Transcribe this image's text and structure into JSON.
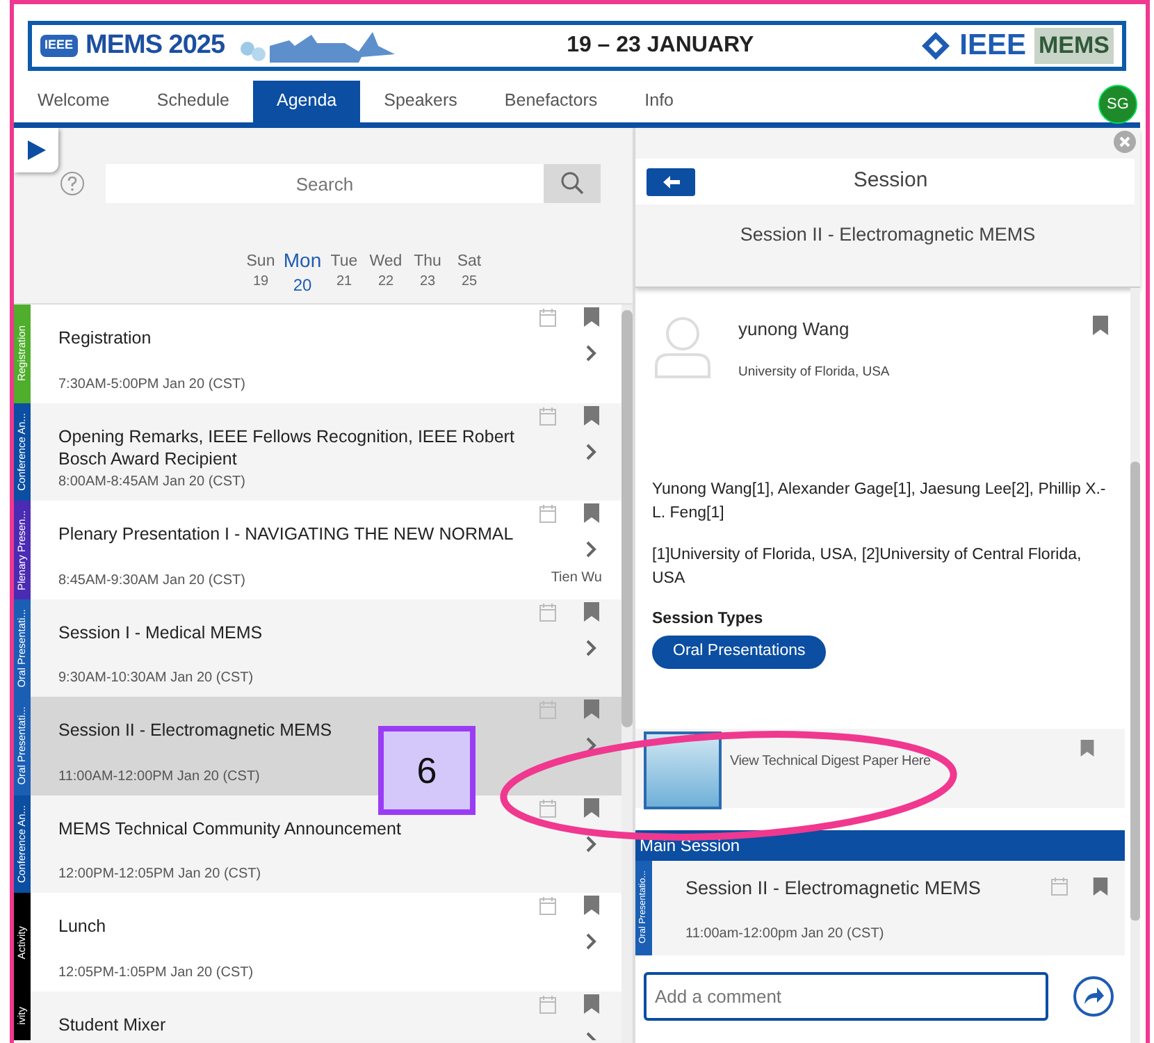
{
  "banner": {
    "logo_badge": "IEEE",
    "logo_text": "MEMS 2025",
    "dates": "19 – 23 JANUARY",
    "org_logo": "IEEE",
    "partner_logo": "MEMS"
  },
  "tabs": [
    {
      "label": "Welcome",
      "selected": false
    },
    {
      "label": "Schedule",
      "selected": false
    },
    {
      "label": "Agenda",
      "selected": true
    },
    {
      "label": "Speakers",
      "selected": false
    },
    {
      "label": "Benefactors",
      "selected": false
    },
    {
      "label": "Info",
      "selected": false
    }
  ],
  "user_avatar": "SG",
  "search": {
    "placeholder": "Search"
  },
  "days": [
    {
      "name": "Sun",
      "date": "19",
      "selected": false
    },
    {
      "name": "Mon",
      "date": "20",
      "selected": true
    },
    {
      "name": "Tue",
      "date": "21",
      "selected": false
    },
    {
      "name": "Wed",
      "date": "22",
      "selected": false
    },
    {
      "name": "Thu",
      "date": "23",
      "selected": false
    },
    {
      "name": "Sat",
      "date": "25",
      "selected": false
    }
  ],
  "agenda": [
    {
      "category": "Registration",
      "color": "#4fae2c",
      "title": "Registration",
      "time": "7:30AM-5:00PM Jan 20 (CST)",
      "selected": false
    },
    {
      "category": "Conference An...",
      "color": "#0b4ea2",
      "title": "Opening Remarks, IEEE Fellows Recognition, IEEE Robert Bosch Award Recipient",
      "time": "8:00AM-8:45AM Jan 20 (CST)",
      "selected": false
    },
    {
      "category": "Plenary Presen...",
      "color": "#4b2bb3",
      "title": "Plenary Presentation I - NAVIGATING THE NEW NORMAL",
      "time": "8:45AM-9:30AM Jan 20 (CST)",
      "speaker": "Tien Wu",
      "selected": false
    },
    {
      "category": "Oral Presentati...",
      "color": "#1a5fb4",
      "title": "Session I - Medical MEMS",
      "time": "9:30AM-10:30AM Jan 20 (CST)",
      "selected": false
    },
    {
      "category": "Oral Presentati...",
      "color": "#1a5fb4",
      "title": "Session II - Electromagnetic MEMS",
      "time": "11:00AM-12:00PM Jan 20 (CST)",
      "selected": true
    },
    {
      "category": "Conference An...",
      "color": "#0b4ea2",
      "title": "MEMS Technical Community Announcement",
      "time": "12:00PM-12:05PM Jan 20 (CST)",
      "selected": false
    },
    {
      "category": "Activity",
      "color": "#000000",
      "title": "Lunch",
      "time": "12:05PM-1:05PM Jan 20 (CST)",
      "selected": false
    },
    {
      "category": "ivity",
      "color": "#000000",
      "title": "Student Mixer",
      "selected": false
    }
  ],
  "detail": {
    "header": "Session",
    "subtitle": "Session II - Electromagnetic MEMS",
    "speaker": {
      "name": "yunong Wang",
      "affiliation": "University of Florida, USA"
    },
    "authors": "Yunong Wang[1], Alexander Gage[1], Jaesung Lee[2], Phillip X.-L. Feng[1]",
    "affiliations": "[1]University of Florida, USA, [2]University of Central Florida, USA",
    "session_types_label": "Session Types",
    "session_types": [
      "Oral Presentations"
    ],
    "manuscript": {
      "label": "View Technical Digest Paper Here"
    },
    "main_session": {
      "header": "Main Session",
      "category": "Oral Presentatio...",
      "color": "#1a5fb4",
      "title": "Session II - Electromagnetic MEMS",
      "time": "11:00am-12:00pm Jan 20 (CST)"
    },
    "comment": {
      "placeholder": "Add a comment"
    }
  },
  "annotation": {
    "callout": "6"
  }
}
